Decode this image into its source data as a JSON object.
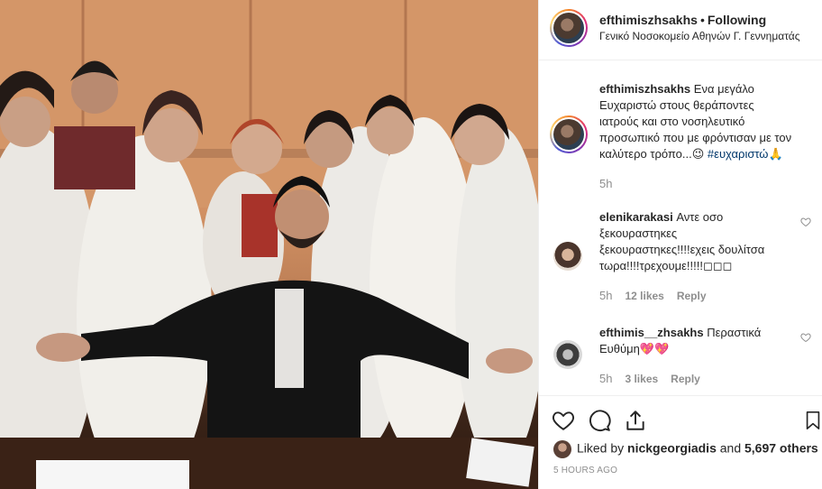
{
  "post": {
    "username": "efthimiszhsakhs",
    "separator": "•",
    "follow_status": "Following",
    "location": "Γενικό Νοσοκομείο Αθηνών Γ. Γεννηματάς"
  },
  "caption": {
    "username": "efthimiszhsakhs",
    "lines": [
      "Ενα μεγάλο",
      "Ευχαριστώ στους θεράποντες",
      "ιατρούς και στο νοσηλευτικό",
      "προσωπικό που με φρόντισαν με τον",
      "καλύτερο τρόπο...😉 "
    ],
    "hashtag": "#ευχαριστώ🙏",
    "time": "5h"
  },
  "comments": [
    {
      "username": "elenikarakasi",
      "lines": [
        "Αντε οσο",
        "ξεκουραστηκες",
        "ξεκουραστηκες!!!!εχεις δουλίτσα",
        "τωρα!!!!τρεχουμε!!!!!◻◻◻"
      ],
      "time": "5h",
      "likes": "12 likes",
      "reply": "Reply"
    },
    {
      "username": "efthimis__zhsakhs",
      "lines": [
        "Περαστικά",
        "Ευθύμη💖💖"
      ],
      "time": "5h",
      "likes": "3 likes",
      "reply": "Reply"
    }
  ],
  "actions": {
    "liked_prefix": "Liked by",
    "liked_user": "nickgeorgiadis",
    "liked_and": "and",
    "liked_others": "5,697 others",
    "posted_ago": "5 HOURS AGO"
  },
  "icons": [
    "heart-icon",
    "comment-icon",
    "share-icon",
    "bookmark-icon"
  ],
  "colors": {
    "link": "#00376b",
    "muted": "#8e8e8e",
    "text": "#262626",
    "border": "#efefef"
  }
}
